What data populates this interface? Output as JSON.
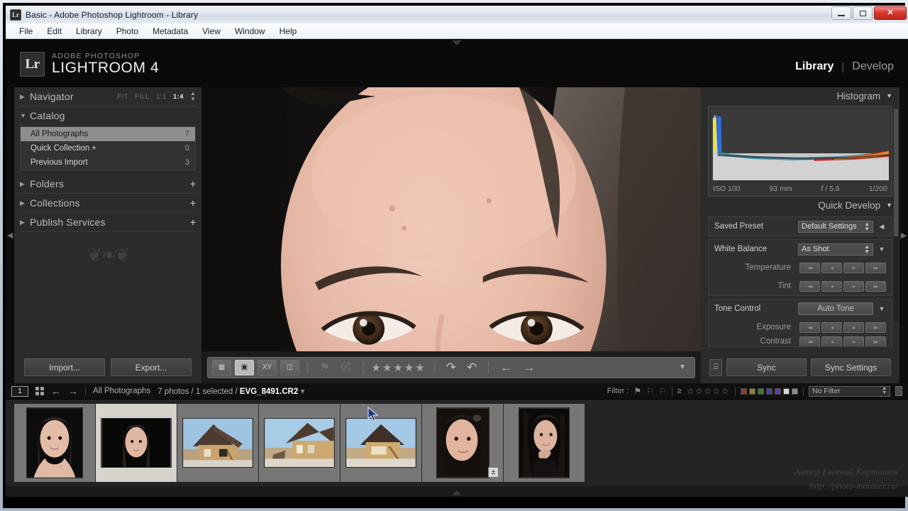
{
  "window": {
    "title": "Basic - Adobe Photoshop Lightroom - Library",
    "icon": "lr-icon",
    "controls": {
      "minimize": "–",
      "maximize": "□",
      "close": "✕"
    }
  },
  "menubar": {
    "items": [
      "File",
      "Edit",
      "Library",
      "Photo",
      "Metadata",
      "View",
      "Window",
      "Help"
    ]
  },
  "identity": {
    "badge": "Lr",
    "brand_line1": "ADOBE PHOTOSHOP",
    "brand_line2": "LIGHTROOM 4"
  },
  "modules": {
    "items": [
      "Library",
      "Develop"
    ],
    "active": "Library",
    "separator": "|"
  },
  "left_panel": {
    "navigator": {
      "title": "Navigator",
      "arrow": "▶",
      "zoom_levels": [
        "FIT",
        "FILL",
        "1:1",
        "1:4"
      ],
      "zoom_active": "1:4"
    },
    "catalog": {
      "title": "Catalog",
      "arrow": "▼",
      "rows": [
        {
          "label": "All Photographs",
          "count": "7",
          "selected": true
        },
        {
          "label": "Quick Collection  +",
          "count": "0",
          "selected": false
        },
        {
          "label": "Previous Import",
          "count": "3",
          "selected": false
        }
      ]
    },
    "sections": [
      {
        "title": "Folders",
        "arrow": "▶",
        "add": "+"
      },
      {
        "title": "Collections",
        "arrow": "▶",
        "add": "+"
      },
      {
        "title": "Publish Services",
        "arrow": "▶",
        "add": "+"
      }
    ],
    "buttons": {
      "import": "Import...",
      "export": "Export..."
    }
  },
  "toolbar": {
    "view_modes": [
      "grid-view",
      "loupe-view",
      "compare-view",
      "survey-view"
    ],
    "flag_pick": "⚑",
    "flag_reject": "☒",
    "stars": "★★★★★",
    "rotate_left": "↷",
    "rotate_right": "↶",
    "prev": "←",
    "next": "→",
    "caret": "▼"
  },
  "right_panel": {
    "histogram": {
      "title": "Histogram",
      "caret": "▼",
      "iso": "ISO 100",
      "focal": "93 mm",
      "aperture": "f / 5.6",
      "shutter": "1/200"
    },
    "quick_develop": {
      "title": "Quick Develop",
      "caret": "▼",
      "saved_preset_label": "Saved Preset",
      "saved_preset_value": "Default Settings",
      "white_balance_label": "White Balance",
      "white_balance_value": "As Shot",
      "temperature_label": "Temperature",
      "tint_label": "Tint",
      "tone_control_label": "Tone Control",
      "auto_tone_label": "Auto Tone",
      "exposure_label": "Exposure",
      "contrast_label": "Contrast"
    },
    "buttons": {
      "sync": "Sync",
      "sync_settings": "Sync Settings",
      "sync_icon": "⌸"
    }
  },
  "filmstrip": {
    "page_number": "1",
    "grid_icon": "grid-icon",
    "back_arrow": "←",
    "forward_arrow": "→",
    "source": "All Photographs",
    "counts_prefix": "7 photos / 1 selected / ",
    "current_file": "EVG_8491.CR2",
    "file_caret": "▾",
    "filter_label": "Filter :",
    "flag_icons": [
      "⚑",
      "⚐",
      "⚐"
    ],
    "rating_prefix": "≥",
    "rating_stars": "☆☆☆☆☆",
    "color_labels": [
      "#8e3b33",
      "#8f8032",
      "#3e7a3c",
      "#3b46a0",
      "#5d3f9e",
      "#d9d9d9",
      "#8c8c8c"
    ],
    "filter_preset": "No Filter",
    "thumbnails": [
      {
        "name": "portrait-gray-bg",
        "type": "portrait-a",
        "selected": false,
        "badge": null
      },
      {
        "name": "portrait-dark-bg",
        "type": "portrait-b",
        "selected": true,
        "badge": null
      },
      {
        "name": "wooden-house-1",
        "type": "house-a",
        "selected": false,
        "badge": null
      },
      {
        "name": "wooden-house-2",
        "type": "house-b",
        "selected": false,
        "badge": null
      },
      {
        "name": "wooden-house-3",
        "type": "house-c",
        "selected": false,
        "badge": null
      },
      {
        "name": "portrait-closeup",
        "type": "portrait-c",
        "selected": false,
        "badge": "±"
      },
      {
        "name": "portrait-hand",
        "type": "portrait-d",
        "selected": false,
        "badge": null
      }
    ]
  },
  "watermark": {
    "line1": "Автор Евгений Карташов",
    "line2": "http://photo-monster.ru/"
  }
}
